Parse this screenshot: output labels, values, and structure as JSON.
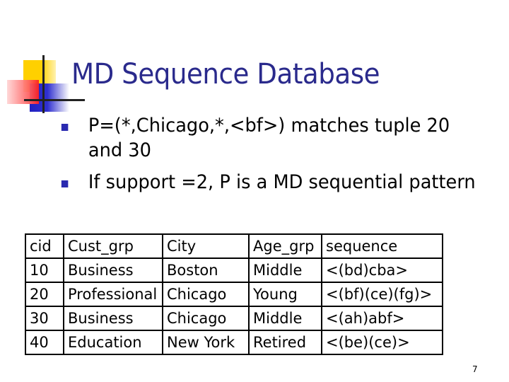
{
  "slide": {
    "title": "MD Sequence Database",
    "logo_icon": "four-square-logo-icon",
    "bullets": [
      {
        "text": "P=(*,Chicago,*,<bf>) matches tuple 20 and 30",
        "marker_color": "#2a2ab0"
      },
      {
        "text": "If support =2, P is a MD sequential pattern",
        "marker_color": "#2a2ab0"
      }
    ],
    "table": {
      "headers": [
        "cid",
        "Cust_grp",
        "City",
        "Age_grp",
        "sequence"
      ],
      "rows": [
        [
          "10",
          "Business",
          "Boston",
          "Middle",
          "<(bd)cba>"
        ],
        [
          "20",
          "Professional",
          "Chicago",
          "Young",
          "<(bf)(ce)(fg)>"
        ],
        [
          "30",
          "Business",
          "Chicago",
          "Middle",
          "<(ah)abf>"
        ],
        [
          "40",
          "Education",
          "New York",
          "Retired",
          "<(be)(ce)>"
        ]
      ]
    },
    "page_number": "7",
    "colors": {
      "title": "#2a2a8c",
      "bullet": "#2a2ab0"
    }
  }
}
